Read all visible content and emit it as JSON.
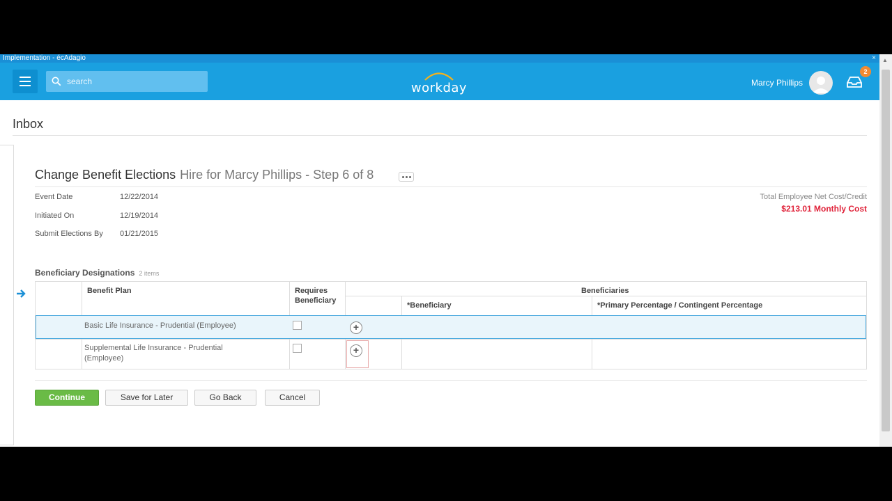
{
  "window": {
    "title": "Implementation - écAdagio",
    "close_glyph": "×"
  },
  "header": {
    "search_placeholder": "search",
    "logo_text": "workday",
    "user_name": "Marcy Phillips",
    "notification_count": "2",
    "colors": {
      "bar": "#1aa0e0",
      "search": "#61bfef",
      "badge": "#f08a32"
    }
  },
  "page": {
    "title": "Inbox",
    "task_title": "Change Benefit Elections",
    "task_subtitle": "Hire for Marcy Phillips - Step 6 of 8"
  },
  "fields": [
    {
      "label": "Event Date",
      "value": "12/22/2014"
    },
    {
      "label": "Initiated On",
      "value": "12/19/2014"
    },
    {
      "label": "Submit Elections By",
      "value": "01/21/2015"
    }
  ],
  "cost": {
    "label": "Total Employee Net Cost/Credit",
    "value": "$213.01 Monthly Cost",
    "color": "#e0233a"
  },
  "grid": {
    "title": "Beneficiary Designations",
    "count": "2 items",
    "headers": {
      "benefit_plan": "Benefit Plan",
      "requires_beneficiary_1": "Requires",
      "requires_beneficiary_2": "Beneficiary",
      "beneficiaries": "Beneficiaries",
      "beneficiary": "*Beneficiary",
      "percentage": "*Primary Percentage / Contingent Percentage"
    },
    "rows": [
      {
        "plan": "Basic Life Insurance - Prudential (Employee)",
        "requires": false
      },
      {
        "plan_line1": "Supplemental Life Insurance - Prudential",
        "plan_line2": "(Employee)",
        "requires": false
      }
    ]
  },
  "actions": {
    "continue": "Continue",
    "save_later": "Save for Later",
    "go_back": "Go Back",
    "cancel": "Cancel"
  }
}
